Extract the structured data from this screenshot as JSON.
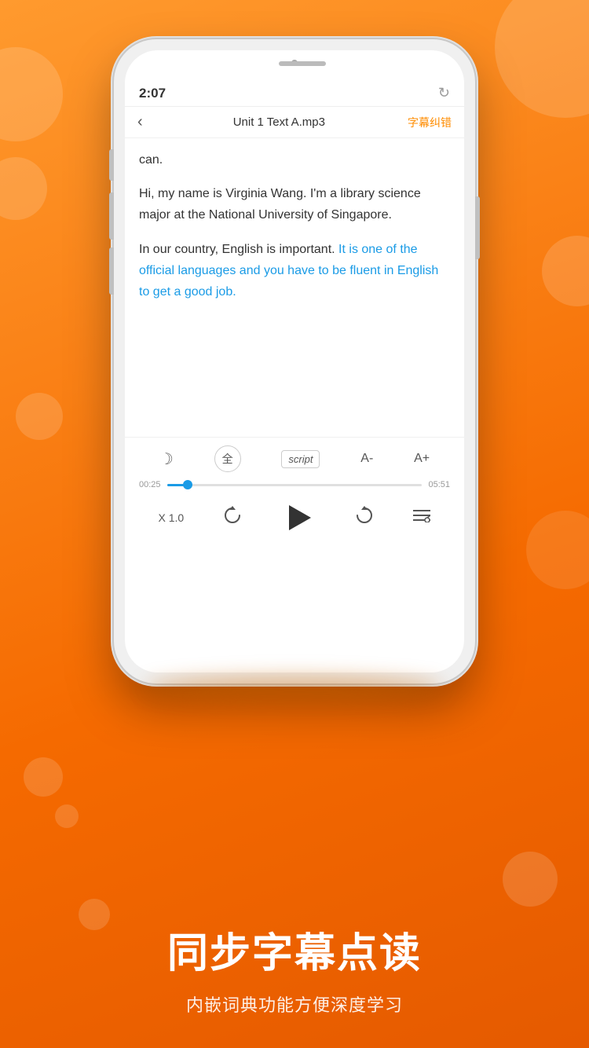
{
  "background": {
    "gradient_start": "#ff9a2e",
    "gradient_end": "#e55a00"
  },
  "phone": {
    "time": "2:07",
    "nav": {
      "back_icon": "‹",
      "title": "Unit 1 Text A.mp3",
      "subtitle": "字幕纠错",
      "refresh_icon": "↻"
    },
    "content": {
      "paragraph1": "can.",
      "paragraph2": "Hi, my name is Virginia Wang. I'm a library science major at the National University of Singapore.",
      "paragraph3_plain": "In our country, English is important. ",
      "paragraph3_highlight": "It is one of the official languages and you have to be fluent in English to get a good job."
    },
    "controls": {
      "moon_icon": "☽",
      "all_label": "全",
      "script_label": "script",
      "font_minus": "A-",
      "font_plus": "A+",
      "time_current": "00:25",
      "time_total": "05:51",
      "progress_percent": 8,
      "speed": "X 1.0",
      "list_icon": "≡"
    }
  },
  "bottom": {
    "main_title": "同步字幕点读",
    "sub_title": "内嵌词典功能方便深度学习"
  }
}
